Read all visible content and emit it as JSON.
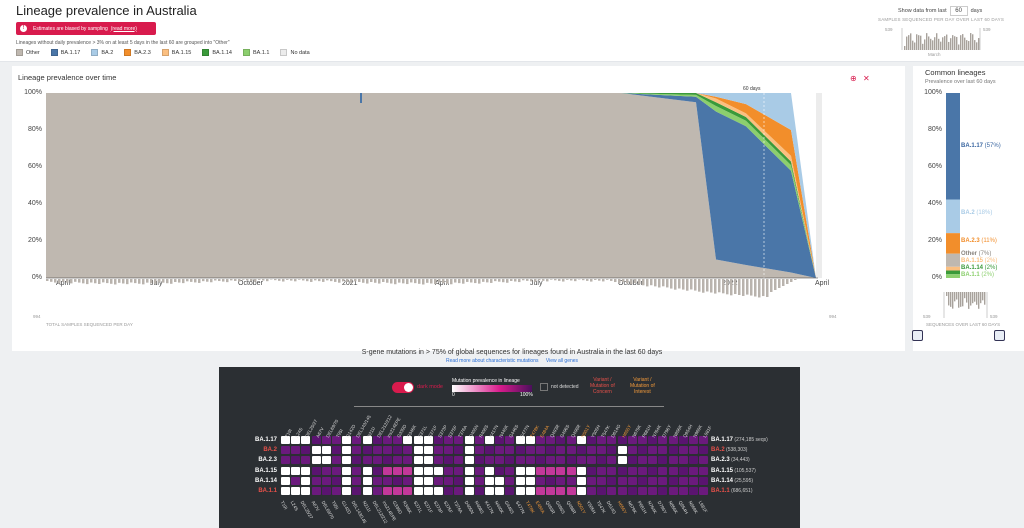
{
  "header": {
    "title": "Lineage prevalence in Australia",
    "warning": {
      "text": "Estimates are biased by sampling",
      "link": "(read more)"
    },
    "note": "Lineages without daily prevalence > 3% on at least 5 days in the last 60 are grouped into \"Other\"",
    "legend": [
      {
        "label": "Other",
        "color": "#bfb8b0"
      },
      {
        "label": "BA.1.17",
        "color": "#4a76a8"
      },
      {
        "label": "BA.2",
        "color": "#a9cbe6"
      },
      {
        "label": "BA.2.3",
        "color": "#f28e2b"
      },
      {
        "label": "BA.1.15",
        "color": "#fbbf80"
      },
      {
        "label": "BA.1.14",
        "color": "#3a9a3a"
      },
      {
        "label": "BA.1.1",
        "color": "#8ccf6e"
      },
      {
        "label": "No data",
        "color": "#ececec"
      }
    ],
    "controls": {
      "prefix": "Show data from last",
      "value": "60",
      "suffix": "days"
    },
    "samples_label": "SAMPLES SEQUENCED PER DAY OVER LAST 60 DAYS",
    "mini_axis": {
      "top": "539",
      "bottom": "0",
      "x": "March"
    }
  },
  "chart": {
    "subtitle": "Lineage prevalence over time",
    "yticks": [
      "100%",
      "80%",
      "60%",
      "40%",
      "20%",
      "0%"
    ],
    "xticks": [
      "April",
      "July",
      "October",
      "2021",
      "April",
      "July",
      "October",
      "2022",
      "April"
    ],
    "window_label": "60 days",
    "total_label": "TOTAL SAMPLES SEQUENCED PER DAY",
    "total_axis": {
      "left": "994",
      "right": "994"
    }
  },
  "chart_data": {
    "type": "area",
    "title": "Lineage prevalence over time",
    "ylabel": "",
    "ylim": [
      0,
      100
    ],
    "x": [
      "2020-04",
      "2020-07",
      "2020-10",
      "2021-01",
      "2021-04",
      "2021-07",
      "2021-10",
      "2021-12",
      "2022-01",
      "2022-02",
      "2022-03",
      "2022-04"
    ],
    "series": [
      {
        "name": "Other",
        "values": [
          100,
          100,
          100,
          100,
          100,
          100,
          100,
          95,
          10,
          7,
          3,
          0
        ]
      },
      {
        "name": "BA.1.17",
        "values": [
          0,
          0,
          0,
          0,
          0,
          0,
          0,
          3,
          80,
          75,
          55,
          0
        ]
      },
      {
        "name": "BA.1.1",
        "values": [
          0,
          0,
          0,
          0,
          0,
          0,
          0,
          1,
          3,
          3,
          3,
          0
        ]
      },
      {
        "name": "BA.1.14",
        "values": [
          0,
          0,
          0,
          0,
          0,
          0,
          0,
          1,
          2,
          2,
          2,
          0
        ]
      },
      {
        "name": "BA.1.15",
        "values": [
          0,
          0,
          0,
          0,
          0,
          0,
          0,
          0,
          2,
          2,
          3,
          0
        ]
      },
      {
        "name": "BA.2.3",
        "values": [
          0,
          0,
          0,
          0,
          0,
          0,
          0,
          0,
          1,
          5,
          14,
          0
        ]
      },
      {
        "name": "BA.2",
        "values": [
          0,
          0,
          0,
          0,
          0,
          0,
          0,
          0,
          2,
          6,
          20,
          0
        ]
      }
    ]
  },
  "common": {
    "title": "Common lineages",
    "subtitle": "Prevalence over last 60 days",
    "yticks": [
      "100%",
      "80%",
      "60%",
      "40%",
      "20%",
      "0%"
    ],
    "items": [
      {
        "name": "BA.1.17",
        "pct": "(57%)",
        "color": "#4a76a8"
      },
      {
        "name": "BA.2",
        "pct": "(18%)",
        "color": "#a9cbe6"
      },
      {
        "name": "BA.2.3",
        "pct": "(11%)",
        "color": "#f28e2b"
      },
      {
        "name": "Other",
        "pct": "(7%)",
        "color": "#bfb8b0"
      },
      {
        "name": "BA.1.15",
        "pct": "(2%)",
        "color": "#fbbf80"
      },
      {
        "name": "BA.1.14",
        "pct": "(2%)",
        "color": "#3a9a3a"
      },
      {
        "name": "BA.1.1",
        "pct": "(2%)",
        "color": "#8ccf6e"
      }
    ],
    "values": [
      57,
      18,
      11,
      7,
      2,
      2,
      2
    ],
    "samples_label": "SEQUENCES OVER LAST 60 DAYS",
    "mini_axis": {
      "left": "539",
      "right": "539"
    }
  },
  "mutations": {
    "title": "S-gene mutations in > 75% of global sequences for lineages found in Australia in the last 60 days",
    "link1": "Read more about characteristic mutations",
    "link2": "View all genes",
    "dark_mode": "dark mode",
    "gradient_label": "Mutation prevalence in lineage",
    "g0": "0",
    "g100": "100%",
    "not_detected": "not detected",
    "voc": "Variant /\nMutation of\nConcern",
    "voi": "Variant /\nMutation of\nInterest",
    "rows": [
      {
        "name": "BA.1.17",
        "count": "(274,185 seqs)",
        "red": false
      },
      {
        "name": "BA.2",
        "count": "(538,303)",
        "red": true
      },
      {
        "name": "BA.2.3",
        "count": "(34,443)",
        "red": false
      },
      {
        "name": "BA.1.15",
        "count": "(105,537)",
        "red": false
      },
      {
        "name": "BA.1.14",
        "count": "(25,595)",
        "red": false
      },
      {
        "name": "BA.1.1",
        "count": "(686,651)",
        "red": true
      }
    ],
    "columns": [
      "T19I",
      "L24S",
      "DEL25/27",
      "A67V",
      "DEL69/70",
      "T95I",
      "G142D",
      "DEL143/145",
      "N211I",
      "DEL212/212",
      "ins214EPE",
      "G339D",
      "R346K",
      "S371L",
      "S371F",
      "S373P",
      "S375F",
      "T376A",
      "D405N",
      "R408S",
      "K417N",
      "N440K",
      "G446S",
      "S477N",
      "T478K",
      "E484A",
      "Q493R",
      "G496S",
      "Q498R",
      "N501Y",
      "Y505H",
      "T547K",
      "D614G",
      "H655Y",
      "N679K",
      "P681H",
      "N764K",
      "D796Y",
      "N856K",
      "Q954H",
      "N969K",
      "L981F"
    ],
    "highlight_cols": [
      24,
      25,
      29,
      33
    ]
  }
}
